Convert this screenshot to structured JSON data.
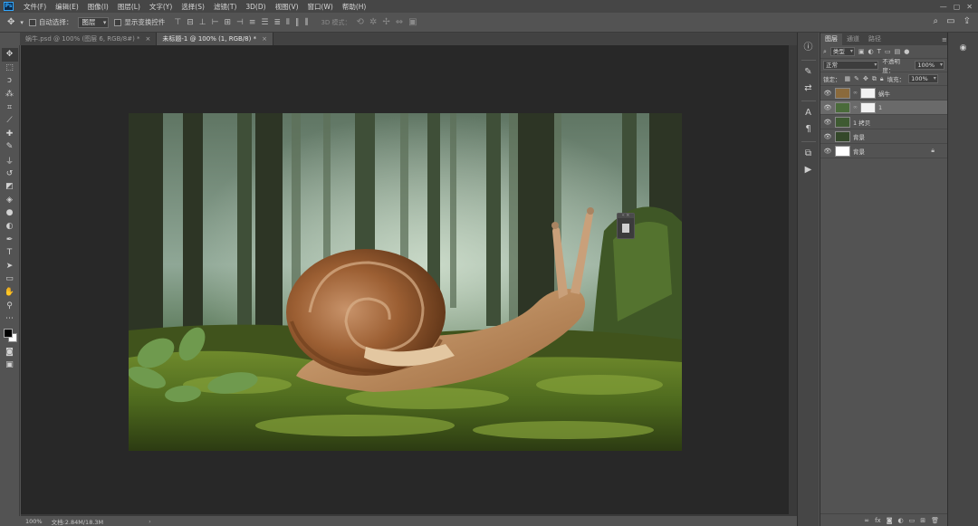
{
  "app": {
    "logo": "Ps"
  },
  "menu": [
    "文件(F)",
    "编辑(E)",
    "图像(I)",
    "图层(L)",
    "文字(Y)",
    "选择(S)",
    "滤镜(T)",
    "3D(D)",
    "视图(V)",
    "窗口(W)",
    "帮助(H)"
  ],
  "options": {
    "auto_select_label": "自动选择：",
    "auto_select_value": "图层",
    "show_transform_label": "显示变换控件",
    "mode_3d_label": "3D 模式："
  },
  "tabs": [
    {
      "label": "蜗牛.psd @ 100% (图层 6, RGB/8#) *",
      "close": "×"
    },
    {
      "label": "未标题-1 @ 100% (1, RGB/8) *",
      "close": "×"
    }
  ],
  "status": {
    "zoom": "100%",
    "doc": "文档:2.84M/18.3M",
    "arrow": "›"
  },
  "layers_panel": {
    "tabs": [
      "图层",
      "通道",
      "路径"
    ],
    "kind_label": "类型",
    "blend_mode": "正常",
    "opacity_label": "不透明度：",
    "opacity_value": "100%",
    "lock_label": "锁定：",
    "fill_label": "填充：",
    "fill_value": "100%",
    "layers": [
      {
        "name": "蜗牛",
        "thumb": "#8a6a3c",
        "mask": true,
        "selected": false,
        "locked": false
      },
      {
        "name": "1",
        "thumb": "#4a6b3a",
        "mask": true,
        "selected": true,
        "locked": false
      },
      {
        "name": "1 拷贝",
        "thumb": "#3e5a32",
        "mask": false,
        "selected": false,
        "locked": false
      },
      {
        "name": "背景",
        "thumb": "#34482a",
        "mask": false,
        "selected": false,
        "locked": false
      },
      {
        "name": "背景",
        "thumb": "#ffffff",
        "mask": false,
        "selected": false,
        "locked": true
      }
    ]
  }
}
